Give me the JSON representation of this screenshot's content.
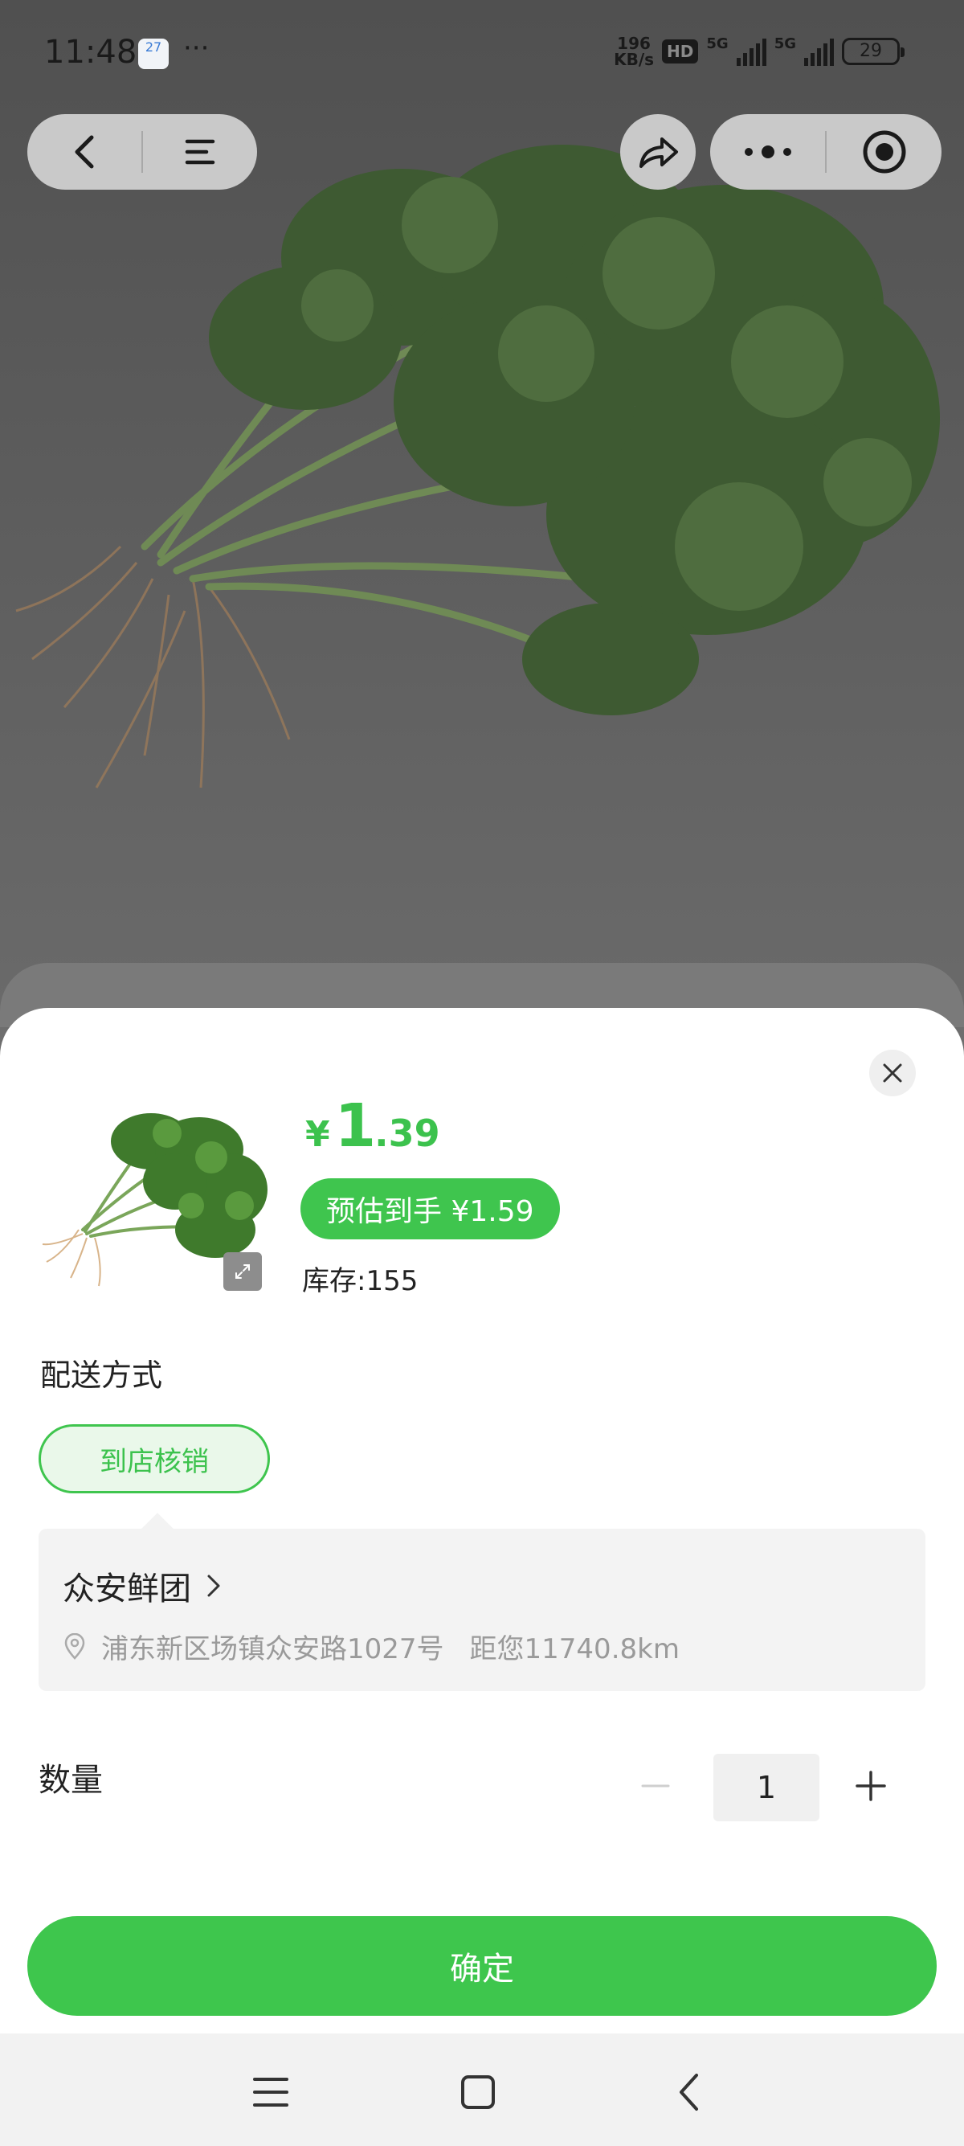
{
  "status_bar": {
    "time": "11:48",
    "calendar_day": "27",
    "more": "···",
    "net_speed_value": "196",
    "net_speed_unit": "KB/s",
    "hd_badge": "HD",
    "sim1_label": "5G",
    "sim2_label": "5G",
    "battery": "29"
  },
  "capsule": {
    "back_icon": "chevron-left-icon",
    "menu_icon": "hamburger-icon",
    "share_icon": "share-arrow-icon",
    "more_icon": "more-dots-icon",
    "close_icon": "target-circle-icon"
  },
  "product": {
    "price_symbol": "¥",
    "price_int": "1",
    "price_dec": ".39",
    "estimate_label": "预估到手 ¥1.59",
    "stock_label": "库存:155"
  },
  "delivery": {
    "title": "配送方式",
    "option": "到店核销",
    "store_name": "众安鲜团",
    "store_address": "浦东新区场镇众安路1027号",
    "store_distance": "距您11740.8km"
  },
  "quantity": {
    "label": "数量",
    "value": "1"
  },
  "confirm_label": "确定",
  "colors": {
    "accent_green": "#3fc54e",
    "chip_bg": "#eaf8ea",
    "card_bg": "#f3f3f3"
  },
  "nav_bar": {
    "menu_icon": "recents-icon",
    "home_icon": "home-square-icon",
    "back_icon": "back-chevron-icon"
  }
}
